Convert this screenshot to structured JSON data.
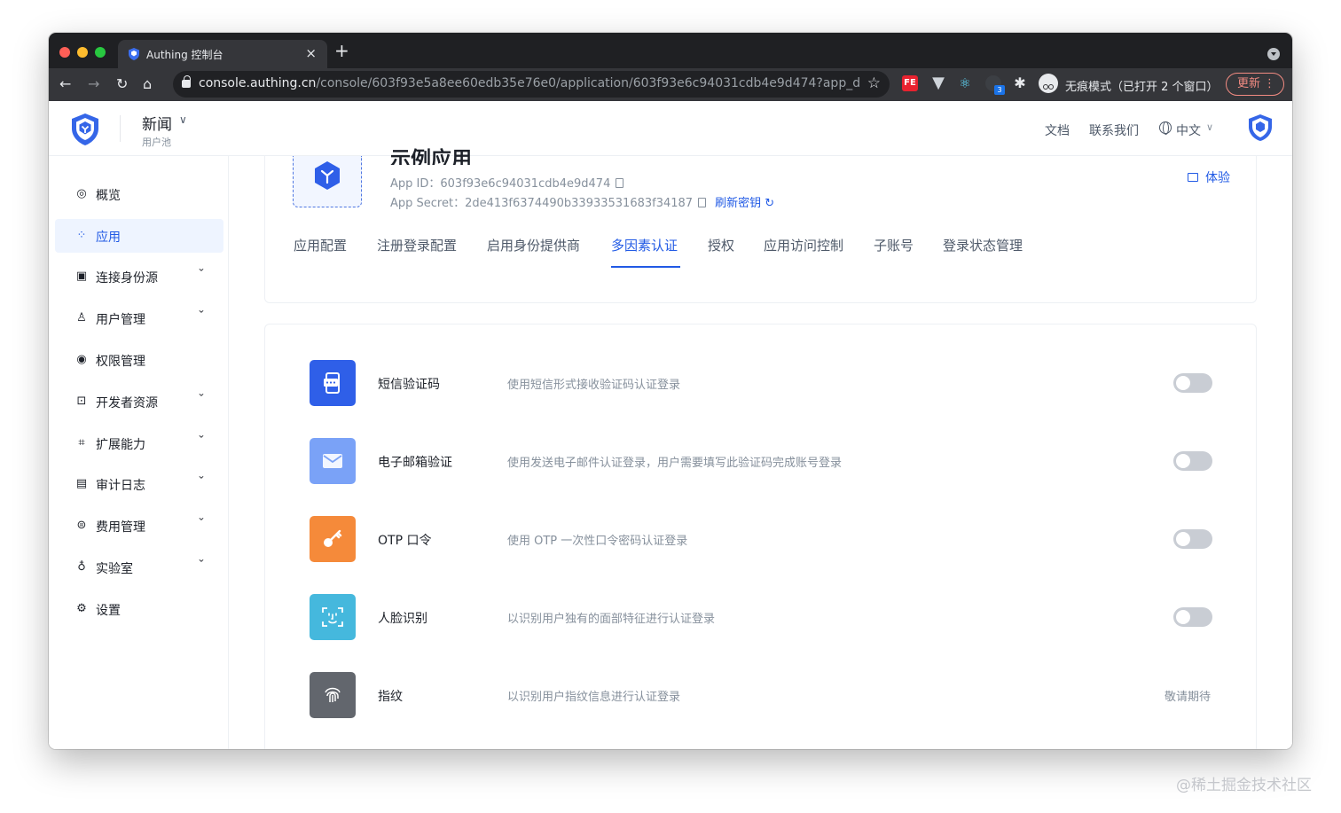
{
  "browser": {
    "tab_title": "Authing 控制台",
    "url_host": "console.authing.cn",
    "url_path": "/console/603f93e5a8ee60edb35e76e0/application/603f93e6c94031cdb4e9d474?app_detail_...",
    "incognito_text": "无痕模式（已打开 2 个窗口）",
    "update_label": "更新",
    "extension_badge": "3",
    "ext_fe_label": "FE"
  },
  "header": {
    "pool_name": "新闻",
    "pool_sub": "用户池",
    "links": {
      "docs": "文档",
      "contact": "联系我们",
      "language": "中文"
    }
  },
  "sidebar": {
    "items": [
      {
        "label": "概览",
        "icon": "dashboard-icon",
        "expandable": false
      },
      {
        "label": "应用",
        "icon": "apps-icon",
        "expandable": false,
        "active": true
      },
      {
        "label": "连接身份源",
        "icon": "identity-source-icon",
        "expandable": true
      },
      {
        "label": "用户管理",
        "icon": "user-icon",
        "expandable": true
      },
      {
        "label": "权限管理",
        "icon": "permission-icon",
        "expandable": false
      },
      {
        "label": "开发者资源",
        "icon": "code-icon",
        "expandable": true
      },
      {
        "label": "扩展能力",
        "icon": "extension-icon",
        "expandable": true
      },
      {
        "label": "审计日志",
        "icon": "log-icon",
        "expandable": true
      },
      {
        "label": "费用管理",
        "icon": "billing-icon",
        "expandable": true
      },
      {
        "label": "实验室",
        "icon": "lab-icon",
        "expandable": true
      },
      {
        "label": "设置",
        "icon": "settings-icon",
        "expandable": false
      }
    ]
  },
  "app": {
    "title": "示例应用",
    "app_id_label": "App ID：",
    "app_id": "603f93e6c94031cdb4e9d474",
    "app_secret_label": "App Secret：",
    "app_secret": "2de413f6374490b33933531683f34187",
    "refresh_label": "刷新密钥",
    "try_label": "体验",
    "tabs": [
      "应用配置",
      "注册登录配置",
      "启用身份提供商",
      "多因素认证",
      "授权",
      "应用访问控制",
      "子账号",
      "登录状态管理"
    ],
    "active_tab": "多因素认证"
  },
  "mfa": {
    "items": [
      {
        "name": "短信验证码",
        "desc": "使用短信形式接收验证码认证登录",
        "icon": "sms-icon",
        "color": "#2f5fe8",
        "enabled": false
      },
      {
        "name": "电子邮箱验证",
        "desc": "使用发送电子邮件认证登录，用户需要填写此验证码完成账号登录",
        "icon": "email-icon",
        "color": "#7aa2f7",
        "enabled": false
      },
      {
        "name": "OTP 口令",
        "desc": "使用 OTP 一次性口令密码认证登录",
        "icon": "key-icon",
        "color": "#f58a3a",
        "enabled": false
      },
      {
        "name": "人脸识别",
        "desc": "以识别用户独有的面部特征进行认证登录",
        "icon": "face-scan-icon",
        "color": "#45b8dd",
        "enabled": false
      },
      {
        "name": "指纹",
        "desc": "以识别用户指纹信息进行认证登录",
        "icon": "fingerprint-icon",
        "color": "#62666d",
        "status": "敬请期待"
      }
    ]
  },
  "colors": {
    "accent": "#215ae5",
    "text": "#1d2129",
    "muted": "#86909c"
  },
  "watermark": "@稀土掘金技术社区"
}
